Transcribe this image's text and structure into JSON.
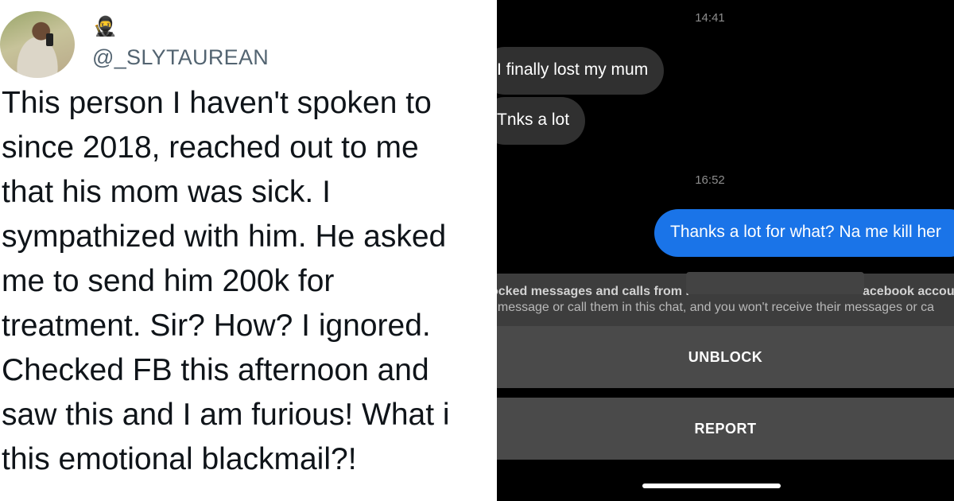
{
  "tweet": {
    "emoji": "🥷",
    "handle": "@_SLYTAUREAN",
    "text": "This person I haven't spoken to\nsince 2018, reached out to me\nthat his mom was sick. I\nsympathized with him. He asked\nme to send him 200k for\ntreatment. Sir? How? I ignored.\nChecked FB this afternoon and\nsaw this and I am furious! What i\nthis emotional blackmail?!"
  },
  "chat": {
    "timestamp_1": "14:41",
    "incoming_1": "I finally lost my mum",
    "incoming_2": "Tnks a lot",
    "timestamp_2": "16:52",
    "outgoing_1": "Thanks a lot for what? Na me kill her",
    "block_title_left": "ocked messages and calls from I",
    "block_title_right": "acebook accou",
    "block_subtitle": "t message or call them in this chat, and you won't receive their messages or ca",
    "unblock_label": "UNBLOCK",
    "report_label": "REPORT"
  },
  "colors": {
    "outgoing_bubble": "#1a74e8",
    "incoming_bubble": "#303030",
    "chat_background": "#000000",
    "handle_text": "#536471"
  }
}
